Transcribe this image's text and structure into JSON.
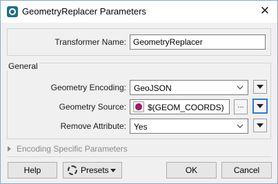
{
  "window": {
    "title": "GeometryReplacer Parameters"
  },
  "transformer": {
    "label": "Transformer Name:",
    "value": "GeometryReplacer"
  },
  "general": {
    "group_label": "General",
    "geometry_encoding": {
      "label": "Geometry Encoding:",
      "value": "GeoJSON"
    },
    "geometry_source": {
      "label": "Geometry Source:",
      "value": "$(GEOM_COORDS)",
      "browse_label": "..."
    },
    "remove_attribute": {
      "label": "Remove Attribute:",
      "value": "Yes"
    }
  },
  "encoding_section": {
    "label": "Encoding Specific Parameters"
  },
  "footer": {
    "help_label": "Help",
    "presets_label": "Presets",
    "ok_label": "OK",
    "cancel_label": "Cancel"
  },
  "icons": {
    "app": "fme-app-icon",
    "close": "close-icon",
    "chevron": "chevron-down-icon",
    "menu": "triangle-down-icon",
    "attribute": "attribute-value-icon",
    "presets": "gear-icon"
  },
  "colors": {
    "accent": "#2b7bd8",
    "app_icon": "#1f6f86",
    "attribute_icon": "#b01e68"
  }
}
